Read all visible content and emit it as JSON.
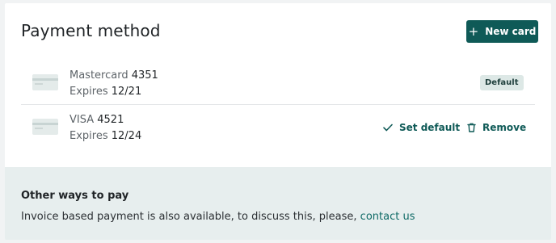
{
  "header": {
    "title": "Payment method",
    "new_card_icon": "plus-icon",
    "new_card_label": "New card"
  },
  "cards": [
    {
      "brand": "Mastercard",
      "number": "4351",
      "expires_label": "Expires",
      "expires": "12/21",
      "badge": "Default",
      "icon": "credit-card-icon"
    },
    {
      "brand": "VISA",
      "number": "4521",
      "expires_label": "Expires",
      "expires": "12/24",
      "icon": "credit-card-icon",
      "actions": {
        "set_default_icon": "checkmark-icon",
        "set_default_label": "Set default",
        "remove_icon": "trash-icon",
        "remove_label": "Remove"
      }
    }
  ],
  "other_ways": {
    "title": "Other ways to pay",
    "text": "Invoice based payment is also available, to discuss this, please,",
    "link_text": "contact us"
  },
  "colors": {
    "accent": "#0f5a57",
    "badge_bg": "#dde8e6",
    "section_bg": "#e7eeee"
  }
}
